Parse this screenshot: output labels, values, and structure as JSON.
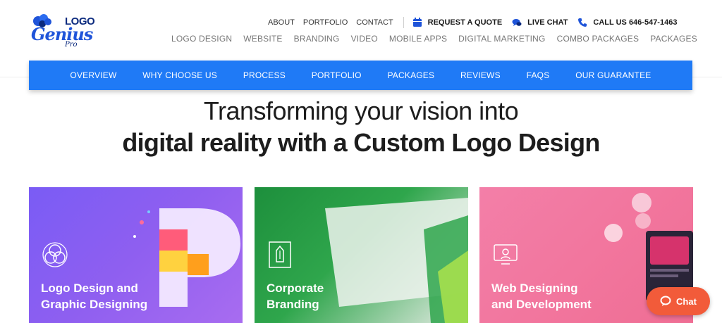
{
  "logo": {
    "word": "LOGO",
    "script": "Genius",
    "pro": "Pro"
  },
  "top_links": [
    "ABOUT",
    "PORTFOLIO",
    "CONTACT"
  ],
  "actions": {
    "quote": "REQUEST A QUOTE",
    "live_chat": "LIVE CHAT",
    "call": "CALL US 646-547-1463"
  },
  "main_nav": [
    "LOGO DESIGN",
    "WEBSITE",
    "BRANDING",
    "VIDEO",
    "MOBILE APPS",
    "DIGITAL MARKETING",
    "COMBO PACKAGES",
    "PACKAGES"
  ],
  "section_nav": [
    "OVERVIEW",
    "WHY CHOOSE US",
    "PROCESS",
    "PORTFOLIO",
    "PACKAGES",
    "REVIEWS",
    "FAQS",
    "OUR GUARANTEE"
  ],
  "headline": {
    "line1": "Transforming your vision into",
    "line2": "digital reality with a Custom Logo Design"
  },
  "cards": [
    {
      "line1": "Logo Design and",
      "line2": "Graphic Designing",
      "icon": "cycle-icon"
    },
    {
      "line1": "Corporate",
      "line2": "Branding",
      "icon": "pen-doc-icon"
    },
    {
      "line1": "Web Designing",
      "line2": "and Development",
      "icon": "monitor-icon"
    }
  ],
  "chat_button": "Chat",
  "colors": {
    "accent": "#1f7af6",
    "brand_dark": "#0b2a7e",
    "chat": "#f25b3a"
  }
}
